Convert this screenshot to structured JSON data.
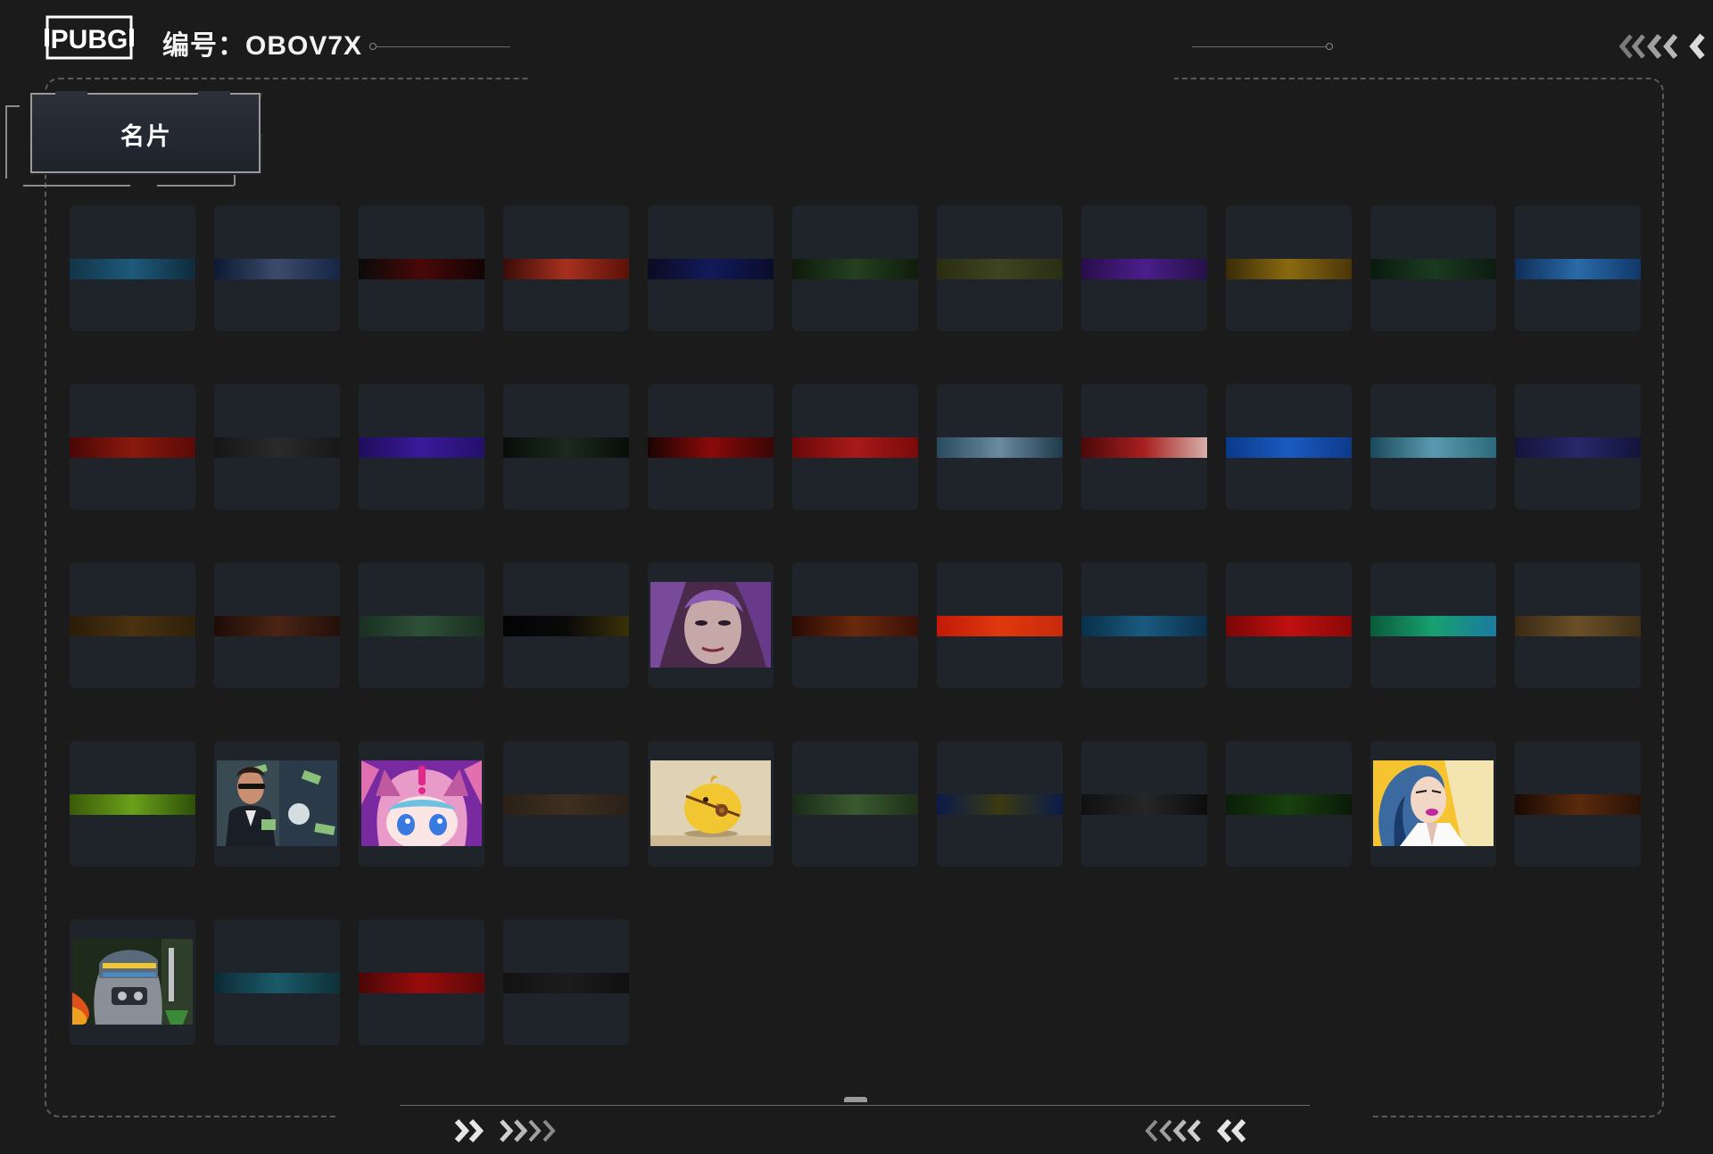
{
  "header": {
    "logo_text": "PUBG",
    "code_label": "编号：OBOV7X",
    "back_icon": "double-chevron-left-icon"
  },
  "tab": {
    "label": "名片"
  },
  "cards": [
    {
      "kind": "strip",
      "colors": [
        "#123447",
        "#1d5a7a",
        "#0f2a3b"
      ]
    },
    {
      "kind": "strip",
      "colors": [
        "#0c1a33",
        "#3b4b6a",
        "#152544"
      ]
    },
    {
      "kind": "strip",
      "colors": [
        "#0a0a0a",
        "#4a0808",
        "#120404"
      ]
    },
    {
      "kind": "strip",
      "colors": [
        "#3a0c08",
        "#a8301e",
        "#5a1208"
      ]
    },
    {
      "kind": "strip",
      "colors": [
        "#0b0b22",
        "#121a5a",
        "#0a0d2a"
      ]
    },
    {
      "kind": "strip",
      "colors": [
        "#0f1a0c",
        "#234020",
        "#101c0c"
      ]
    },
    {
      "kind": "strip",
      "colors": [
        "#2a2d12",
        "#3e4420",
        "#2a2e14"
      ]
    },
    {
      "kind": "strip",
      "colors": [
        "#2a0d4a",
        "#4a1e8a",
        "#26104a"
      ]
    },
    {
      "kind": "strip",
      "colors": [
        "#3a2c08",
        "#8a6a10",
        "#4a3608"
      ]
    },
    {
      "kind": "strip",
      "colors": [
        "#0a1a0e",
        "#1a3a20",
        "#0c1c10"
      ]
    },
    {
      "kind": "strip",
      "colors": [
        "#0e2e58",
        "#2a6aa8",
        "#103868"
      ]
    },
    {
      "kind": "strip",
      "colors": [
        "#4a0606",
        "#8a1a0e",
        "#5a0a06"
      ]
    },
    {
      "kind": "strip",
      "colors": [
        "#161616",
        "#2a2a2a",
        "#181818"
      ]
    },
    {
      "kind": "strip",
      "colors": [
        "#1e0e5a",
        "#3a1a9a",
        "#22106a"
      ]
    },
    {
      "kind": "strip",
      "colors": [
        "#070c08",
        "#1a2a1c",
        "#080e08"
      ]
    },
    {
      "kind": "strip",
      "colors": [
        "#1a0404",
        "#8a0a0a",
        "#3a0606"
      ]
    },
    {
      "kind": "strip",
      "colors": [
        "#6a0808",
        "#a81a1a",
        "#7a0a0a"
      ]
    },
    {
      "kind": "strip",
      "colors": [
        "#2a4a60",
        "#6a8aa0",
        "#1e3a4a"
      ]
    },
    {
      "kind": "strip",
      "colors": [
        "#4a0808",
        "#a82020",
        "#d6b0a8"
      ]
    },
    {
      "kind": "strip",
      "colors": [
        "#0a3a8a",
        "#1a5ac0",
        "#0c3a8a"
      ]
    },
    {
      "kind": "strip",
      "colors": [
        "#1a4a5a",
        "#5a9ab0",
        "#2a6a7a"
      ]
    },
    {
      "kind": "strip",
      "colors": [
        "#14143a",
        "#26286a",
        "#12143a"
      ]
    },
    {
      "kind": "strip",
      "colors": [
        "#2a1c08",
        "#4a3210",
        "#2e200a"
      ]
    },
    {
      "kind": "strip",
      "colors": [
        "#1e0c08",
        "#4a2414",
        "#24100a"
      ]
    },
    {
      "kind": "strip",
      "colors": [
        "#1a3022",
        "#2e5038",
        "#1a3020"
      ]
    },
    {
      "kind": "strip",
      "colors": [
        "#030303",
        "#0a0a0a",
        "#3a3008"
      ]
    },
    {
      "kind": "pic",
      "art": "portrait"
    },
    {
      "kind": "strip",
      "colors": [
        "#2a0a04",
        "#6a2a0c",
        "#3a1008"
      ]
    },
    {
      "kind": "strip",
      "colors": [
        "#c01a08",
        "#e0380e",
        "#c82a0a"
      ]
    },
    {
      "kind": "strip",
      "colors": [
        "#083048",
        "#1a5a80",
        "#0a2e48"
      ]
    },
    {
      "kind": "strip",
      "colors": [
        "#7a0606",
        "#c01010",
        "#8a0808"
      ]
    },
    {
      "kind": "strip",
      "colors": [
        "#0a5a3a",
        "#18a070",
        "#1a7aa0"
      ]
    },
    {
      "kind": "strip",
      "colors": [
        "#3a2a14",
        "#6a5028",
        "#3e2e16"
      ]
    },
    {
      "kind": "strip",
      "colors": [
        "#3a5a0a",
        "#6aa01a",
        "#2e5008"
      ]
    },
    {
      "kind": "pic",
      "art": "agent"
    },
    {
      "kind": "pic",
      "art": "anime"
    },
    {
      "kind": "strip",
      "colors": [
        "#2a2018",
        "#3e3020",
        "#2a2018"
      ]
    },
    {
      "kind": "pic",
      "art": "chick"
    },
    {
      "kind": "strip",
      "colors": [
        "#1a2a18",
        "#3a5a30",
        "#1e3018"
      ]
    },
    {
      "kind": "strip",
      "colors": [
        "#0a1a4a",
        "#3a3a10",
        "#0c1c4a"
      ]
    },
    {
      "kind": "strip",
      "colors": [
        "#101010",
        "#262626",
        "#0c0c0c"
      ]
    },
    {
      "kind": "strip",
      "colors": [
        "#0a1e08",
        "#18400e",
        "#0a1a08"
      ]
    },
    {
      "kind": "pic",
      "art": "comic"
    },
    {
      "kind": "strip",
      "colors": [
        "#1a0a04",
        "#5a2a0c",
        "#2a1206"
      ]
    },
    {
      "kind": "pic",
      "art": "helmet"
    },
    {
      "kind": "strip",
      "colors": [
        "#0c2a34",
        "#1a5a6a",
        "#0e3038"
      ]
    },
    {
      "kind": "strip",
      "colors": [
        "#4a0606",
        "#9a0c0c",
        "#5a0808"
      ]
    },
    {
      "kind": "strip",
      "colors": [
        "#121212",
        "#1c1c1c",
        "#101010"
      ]
    }
  ]
}
